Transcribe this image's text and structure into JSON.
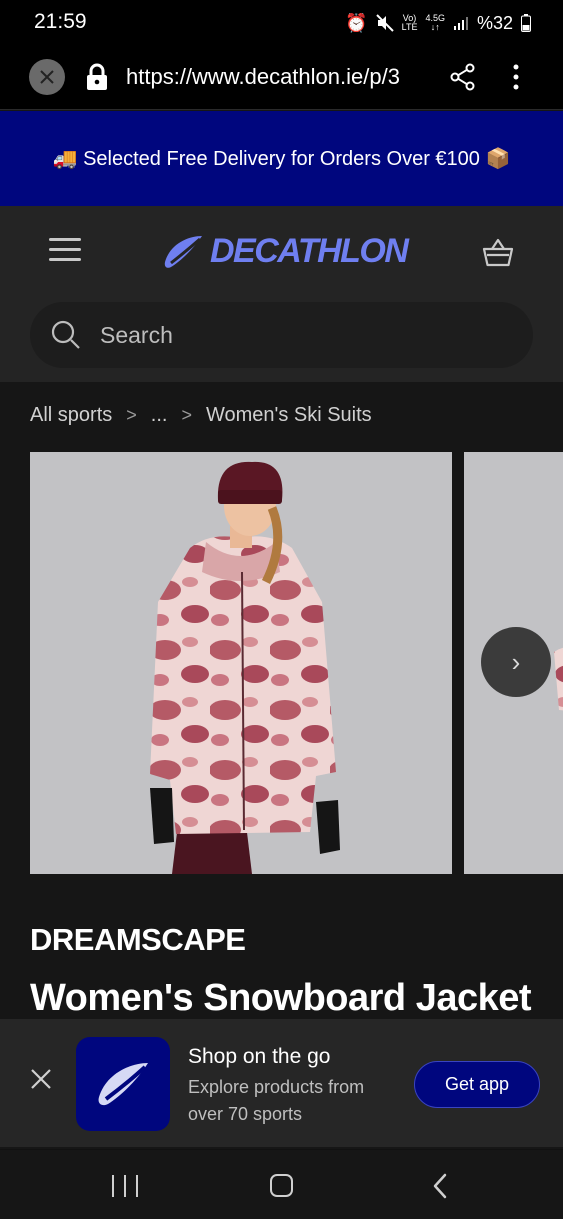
{
  "status_bar": {
    "time": "21:59",
    "network_top": "Vo)",
    "network_bottom": "LTE",
    "gen_top": "4.5G",
    "gen_bottom": "↓↑",
    "battery": "%32"
  },
  "browser": {
    "url": "https://www.decathlon.ie/p/3"
  },
  "promo_banner": {
    "text": "🚚 Selected Free Delivery for Orders Over €100 📦"
  },
  "header": {
    "logo_text": "DECATHLON",
    "search_placeholder": "Search"
  },
  "breadcrumb": {
    "items": [
      "All sports",
      "...",
      "Women's Ski Suits"
    ],
    "separator": ">"
  },
  "gallery": {
    "next_symbol": "›"
  },
  "product": {
    "brand": "DREAMSCAPE",
    "title": "Women's Snowboard Jacket"
  },
  "app_promo": {
    "title": "Shop on the go",
    "subtitle": "Explore products from over 70 sports",
    "button_label": "Get app"
  },
  "colors": {
    "brand_blue": "#00067e",
    "logo_blue": "#6f7ff0",
    "header_bg": "#242424",
    "page_bg": "#161616"
  }
}
